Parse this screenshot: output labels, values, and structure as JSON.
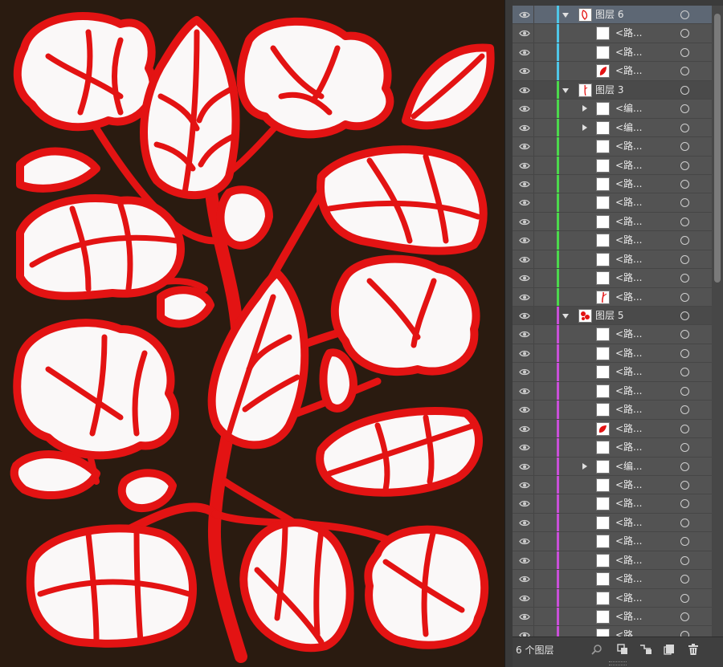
{
  "canvas": {
    "background": "#2a1b10",
    "line_color": "#e31313",
    "fill_color": "#faf8f8"
  },
  "layers_panel": {
    "rows": [
      {
        "kind": "layer",
        "name": "图层 6",
        "expanded": true,
        "selected": true,
        "color": "#4fc6e8",
        "thumb": "layer6"
      },
      {
        "kind": "item",
        "name": "<路...",
        "color": "#4fc6e8",
        "thumb": "blank"
      },
      {
        "kind": "item",
        "name": "<路...",
        "color": "#4fc6e8",
        "thumb": "blank"
      },
      {
        "kind": "item",
        "name": "<路...",
        "color": "#4fc6e8",
        "thumb": "leaf"
      },
      {
        "kind": "layer",
        "name": "图层 3",
        "expanded": true,
        "color": "#4cd94c",
        "thumb": "layer3"
      },
      {
        "kind": "item",
        "name": "<编...",
        "color": "#4cd94c",
        "thumb": "blank",
        "has_children": true
      },
      {
        "kind": "item",
        "name": "<编...",
        "color": "#4cd94c",
        "thumb": "blank",
        "has_children": true
      },
      {
        "kind": "item",
        "name": "<路...",
        "color": "#4cd94c",
        "thumb": "blank"
      },
      {
        "kind": "item",
        "name": "<路...",
        "color": "#4cd94c",
        "thumb": "blank"
      },
      {
        "kind": "item",
        "name": "<路...",
        "color": "#4cd94c",
        "thumb": "blank"
      },
      {
        "kind": "item",
        "name": "<路...",
        "color": "#4cd94c",
        "thumb": "blank"
      },
      {
        "kind": "item",
        "name": "<路...",
        "color": "#4cd94c",
        "thumb": "blank"
      },
      {
        "kind": "item",
        "name": "<路...",
        "color": "#4cd94c",
        "thumb": "blank"
      },
      {
        "kind": "item",
        "name": "<路...",
        "color": "#4cd94c",
        "thumb": "blank"
      },
      {
        "kind": "item",
        "name": "<路...",
        "color": "#4cd94c",
        "thumb": "blank"
      },
      {
        "kind": "item",
        "name": "<路...",
        "color": "#4cd94c",
        "thumb": "stem"
      },
      {
        "kind": "layer",
        "name": "图层 5",
        "expanded": true,
        "color": "#c94fd8",
        "thumb": "layer5"
      },
      {
        "kind": "item",
        "name": "<路...",
        "color": "#c94fd8",
        "thumb": "blank"
      },
      {
        "kind": "item",
        "name": "<路...",
        "color": "#c94fd8",
        "thumb": "blank"
      },
      {
        "kind": "item",
        "name": "<路...",
        "color": "#c94fd8",
        "thumb": "blank"
      },
      {
        "kind": "item",
        "name": "<路...",
        "color": "#c94fd8",
        "thumb": "blank"
      },
      {
        "kind": "item",
        "name": "<路...",
        "color": "#c94fd8",
        "thumb": "blank"
      },
      {
        "kind": "item",
        "name": "<路...",
        "color": "#c94fd8",
        "thumb": "flower"
      },
      {
        "kind": "item",
        "name": "<路...",
        "color": "#c94fd8",
        "thumb": "blank"
      },
      {
        "kind": "item",
        "name": "<编...",
        "color": "#c94fd8",
        "thumb": "blank",
        "has_children": true
      },
      {
        "kind": "item",
        "name": "<路...",
        "color": "#c94fd8",
        "thumb": "blank"
      },
      {
        "kind": "item",
        "name": "<路...",
        "color": "#c94fd8",
        "thumb": "blank"
      },
      {
        "kind": "item",
        "name": "<路...",
        "color": "#c94fd8",
        "thumb": "blank"
      },
      {
        "kind": "item",
        "name": "<路...",
        "color": "#c94fd8",
        "thumb": "blank"
      },
      {
        "kind": "item",
        "name": "<路...",
        "color": "#c94fd8",
        "thumb": "blank"
      },
      {
        "kind": "item",
        "name": "<路...",
        "color": "#c94fd8",
        "thumb": "blank"
      },
      {
        "kind": "item",
        "name": "<路...",
        "color": "#c94fd8",
        "thumb": "blank"
      },
      {
        "kind": "item",
        "name": "<路...",
        "color": "#c94fd8",
        "thumb": "blank"
      },
      {
        "kind": "item",
        "name": "<路...",
        "color": "#c94fd8",
        "thumb": "blank"
      }
    ],
    "footer": {
      "count_label": "6 个图层",
      "icons": [
        "search-icon",
        "make-clipping-mask-icon",
        "create-sublayer-icon",
        "new-layer-icon",
        "trash-icon"
      ]
    }
  }
}
